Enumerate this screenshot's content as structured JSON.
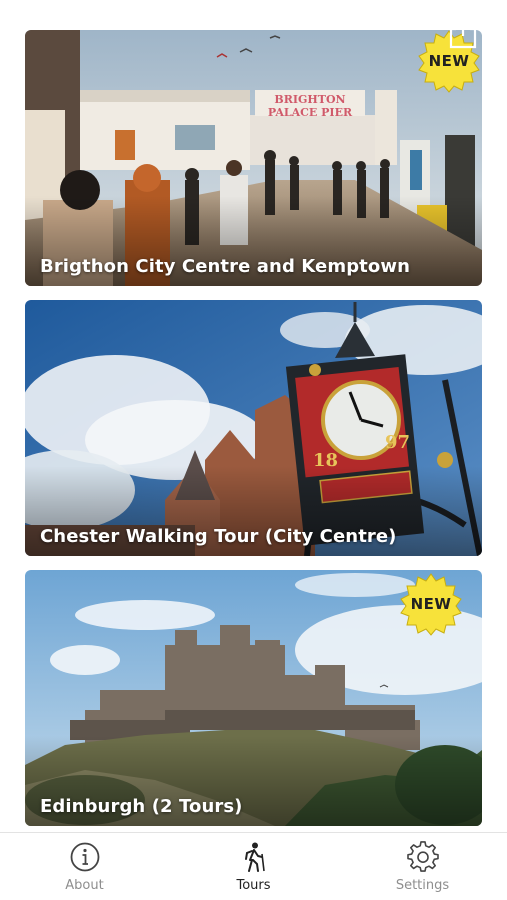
{
  "tours": [
    {
      "title": "Brigthon City Centre and Kemptown",
      "badge": "NEW"
    },
    {
      "title": "Chester Walking Tour (City Centre)"
    },
    {
      "title": "Edinburgh (2 Tours)",
      "badge": "NEW"
    }
  ],
  "share_icon": "share-icon",
  "tabbar": {
    "items": [
      {
        "label": "About",
        "icon": "info-icon"
      },
      {
        "label": "Tours",
        "icon": "hiking-icon",
        "active": true
      },
      {
        "label": "Settings",
        "icon": "gear-icon"
      }
    ]
  },
  "colors": {
    "badge": "#f7e23a",
    "active_tab": "#222222",
    "inactive_tab": "#8e8e8e"
  },
  "pier_sign": "BRIGHTON PALACE PIER",
  "clock_numerals": [
    "18",
    "97"
  ]
}
